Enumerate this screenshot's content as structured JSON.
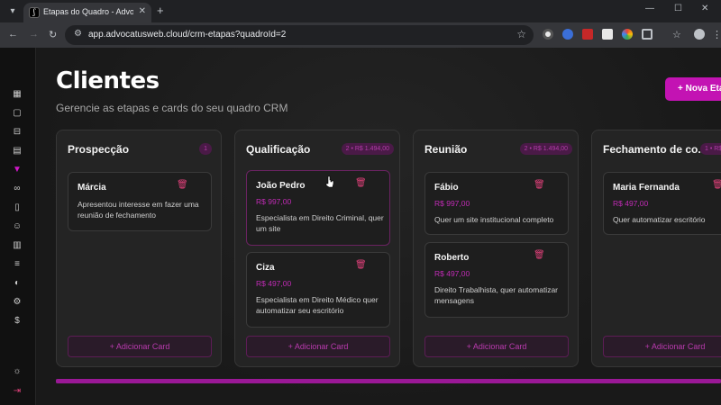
{
  "browser": {
    "tab_title": "Etapas do Quadro - Advocatus",
    "tab_favicon": "advocatus-logo-icon",
    "url": "app.advocatusweb.cloud/crm-etapas?quadroId=2"
  },
  "page": {
    "title": "Clientes",
    "subtitle": "Gerencie as etapas e cards do seu quadro CRM",
    "new_stage_label": "+ Nova Etapa"
  },
  "add_card_label": "+ Adicionar Card",
  "columns": [
    {
      "title": "Prospecção",
      "badge": "1",
      "cards": [
        {
          "name": "Márcia",
          "price": "",
          "desc": "Apresentou interesse em fazer uma reunião de fechamento"
        }
      ]
    },
    {
      "title": "Qualificação",
      "badge": "2 • R$ 1.494,00",
      "cards": [
        {
          "name": "João Pedro",
          "price": "R$ 997,00",
          "desc": "Especialista em Direito Criminal, quer um site"
        },
        {
          "name": "Ciza",
          "price": "R$ 497,00",
          "desc": "Especialista em Direito Médico quer automatizar seu escritório"
        }
      ]
    },
    {
      "title": "Reunião",
      "badge": "2 • R$ 1.494,00",
      "cards": [
        {
          "name": "Fábio",
          "price": "R$ 997,00",
          "desc": "Quer um site institucional completo"
        },
        {
          "name": "Roberto",
          "price": "R$ 497,00",
          "desc": "Direito Trabalhista, quer automatizar mensagens"
        }
      ]
    },
    {
      "title": "Fechamento de co...",
      "badge": "1 • R$",
      "cards": [
        {
          "name": "Maria Fernanda",
          "price": "R$ 497,00",
          "desc": "Quer automatizar escritório"
        }
      ]
    }
  ],
  "colors": {
    "accent": "#c313b3",
    "danger": "#e0407a",
    "background": "#181818"
  }
}
